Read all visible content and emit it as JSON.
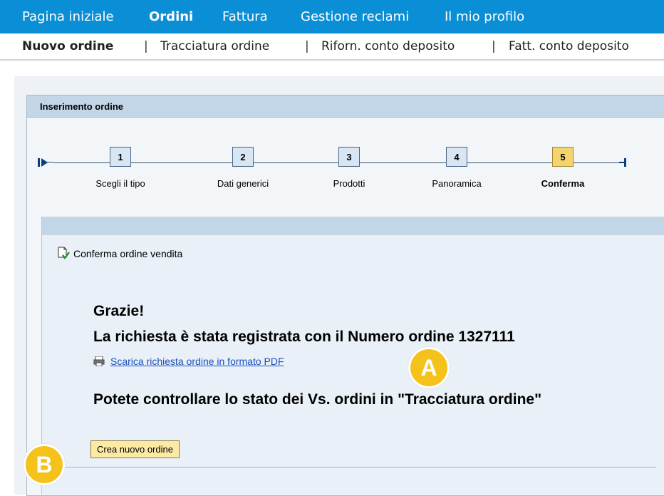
{
  "topnav": {
    "items": [
      {
        "label": "Pagina iniziale",
        "active": false
      },
      {
        "label": "Ordini",
        "active": true
      },
      {
        "label": "Fattura",
        "active": false
      },
      {
        "label": "Gestione reclami",
        "active": false
      },
      {
        "label": "Il mio profilo",
        "active": false
      }
    ]
  },
  "subnav": {
    "items": [
      {
        "label": "Nuovo ordine",
        "active": true
      },
      {
        "label": "Tracciatura ordine",
        "active": false
      },
      {
        "label": "Riforn. conto deposito",
        "active": false
      },
      {
        "label": "Fatt. conto deposito",
        "active": false
      }
    ],
    "separator": "|"
  },
  "panel": {
    "title": "Inserimento ordine"
  },
  "stepper": {
    "current_step": 5,
    "steps": [
      {
        "number": "1",
        "label": "Scegli il tipo"
      },
      {
        "number": "2",
        "label": "Dati generici"
      },
      {
        "number": "3",
        "label": "Prodotti"
      },
      {
        "number": "4",
        "label": "Panoramica"
      },
      {
        "number": "5",
        "label": "Conferma"
      }
    ]
  },
  "confirmation": {
    "heading": "Conferma ordine vendita",
    "thanks": "Grazie!",
    "registered": "La richiesta è stata registrata con il Numero ordine 1327111",
    "pdf_link": "Scarica richiesta ordine in formato PDF",
    "check_status": "Potete controllare lo stato dei Vs. ordini in \"Tracciatura ordine\"",
    "new_order_button": "Crea nuovo ordine"
  },
  "markers": {
    "a": "A",
    "b": "B"
  },
  "colors": {
    "topnav_bg": "#0a8fd6",
    "panel_header_bg": "#c3d6e8",
    "current_step_bg": "#f5d36e",
    "marker_bg": "#f5c21b",
    "link": "#1a4fbf"
  }
}
